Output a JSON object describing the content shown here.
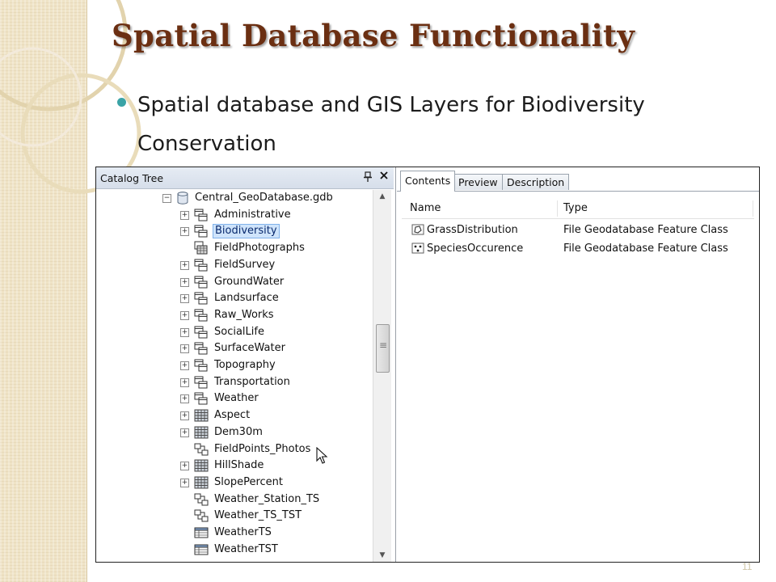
{
  "slide": {
    "title": "Spatial Database Functionality",
    "bullet": "Spatial database and GIS Layers for Biodiversity Conservation",
    "page_number": "11",
    "colors": {
      "title": "#6b2f12",
      "bullet": "#3aa3a6",
      "band": "#efe3c6"
    }
  },
  "catalog": {
    "title": "Catalog Tree",
    "pin_icon": "pin-icon",
    "close_icon": "close-icon",
    "root": {
      "label": "Central_GeoDatabase.gdb",
      "icon": "geodatabase-icon",
      "expander": "⊟"
    },
    "items": [
      {
        "label": "Administrative",
        "icon": "feature-dataset-icon",
        "expander": "+",
        "selected": false
      },
      {
        "label": "Biodiversity",
        "icon": "feature-dataset-icon",
        "expander": "+",
        "selected": true
      },
      {
        "label": "FieldPhotographs",
        "icon": "raster-catalog-icon",
        "expander": "",
        "selected": false
      },
      {
        "label": "FieldSurvey",
        "icon": "feature-dataset-icon",
        "expander": "+",
        "selected": false
      },
      {
        "label": "GroundWater",
        "icon": "feature-dataset-icon",
        "expander": "+",
        "selected": false
      },
      {
        "label": "Landsurface",
        "icon": "feature-dataset-icon",
        "expander": "+",
        "selected": false
      },
      {
        "label": "Raw_Works",
        "icon": "feature-dataset-icon",
        "expander": "+",
        "selected": false
      },
      {
        "label": "SocialLife",
        "icon": "feature-dataset-icon",
        "expander": "+",
        "selected": false
      },
      {
        "label": "SurfaceWater",
        "icon": "feature-dataset-icon",
        "expander": "+",
        "selected": false
      },
      {
        "label": "Topography",
        "icon": "feature-dataset-icon",
        "expander": "+",
        "selected": false
      },
      {
        "label": "Transportation",
        "icon": "feature-dataset-icon",
        "expander": "+",
        "selected": false
      },
      {
        "label": "Weather",
        "icon": "feature-dataset-icon",
        "expander": "+",
        "selected": false
      },
      {
        "label": "Aspect",
        "icon": "raster-icon",
        "expander": "+",
        "selected": false
      },
      {
        "label": "Dem30m",
        "icon": "raster-icon",
        "expander": "+",
        "selected": false
      },
      {
        "label": "FieldPoints_Photos",
        "icon": "relationship-class-icon",
        "expander": "",
        "selected": false
      },
      {
        "label": "HillShade",
        "icon": "raster-icon",
        "expander": "+",
        "selected": false
      },
      {
        "label": "SlopePercent",
        "icon": "raster-icon",
        "expander": "+",
        "selected": false
      },
      {
        "label": "Weather_Station_TS",
        "icon": "relationship-class-icon",
        "expander": "",
        "selected": false
      },
      {
        "label": "Weather_TS_TST",
        "icon": "relationship-class-icon",
        "expander": "",
        "selected": false
      },
      {
        "label": "WeatherTS",
        "icon": "table-icon",
        "expander": "",
        "selected": false
      },
      {
        "label": "WeatherTST",
        "icon": "table-icon",
        "expander": "",
        "selected": false
      }
    ]
  },
  "contents": {
    "tabs": [
      {
        "label": "Contents",
        "active": true
      },
      {
        "label": "Preview",
        "active": false
      },
      {
        "label": "Description",
        "active": false
      }
    ],
    "columns": {
      "name": "Name",
      "type": "Type"
    },
    "rows": [
      {
        "name": "GrassDistribution",
        "type": "File Geodatabase Feature Class",
        "icon": "polygon-feature-class-icon"
      },
      {
        "name": "SpeciesOccurence",
        "type": "File Geodatabase Feature Class",
        "icon": "point-feature-class-icon"
      }
    ]
  }
}
